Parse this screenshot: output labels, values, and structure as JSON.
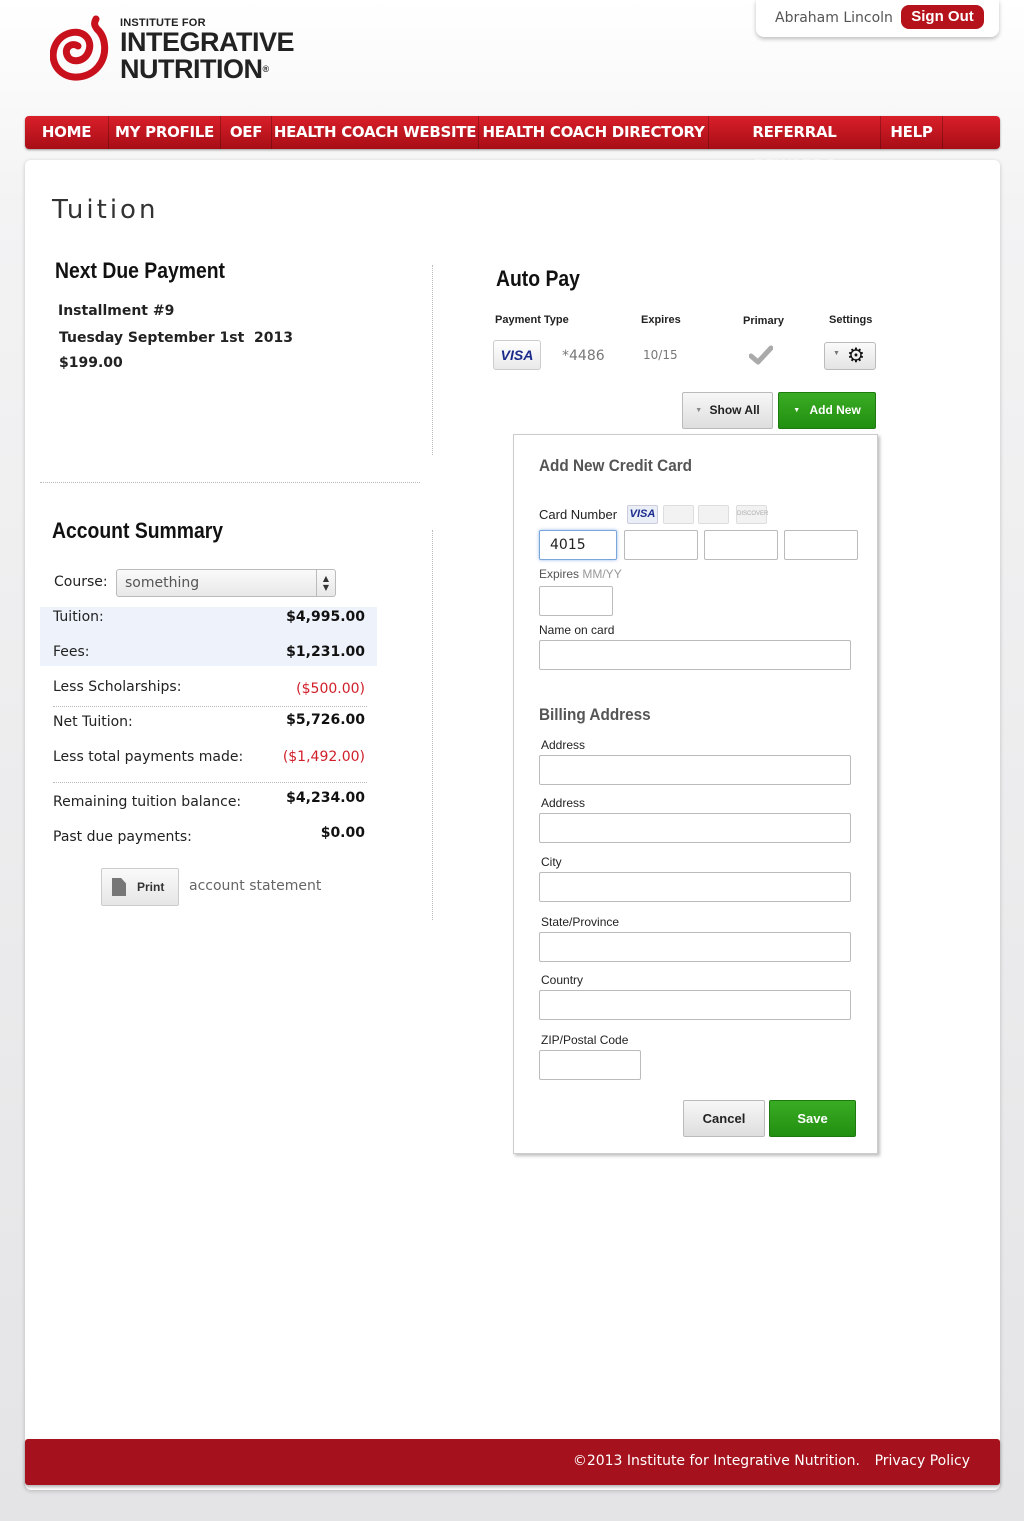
{
  "brand": {
    "logo_top": "INSTITUTE FOR",
    "logo_line1": "INTEGRATIVE",
    "logo_line2": "NUTRITION",
    "registered": "®",
    "accent_color": "#b5121b",
    "green_color": "#2a9a17"
  },
  "user": {
    "name": "Abraham Lincoln",
    "sign_out_label": "Sign Out"
  },
  "nav": {
    "items": [
      {
        "label": "HOME"
      },
      {
        "label": "MY PROFILE"
      },
      {
        "label": "OEF"
      },
      {
        "label": "HEALTH COACH WEBSITE"
      },
      {
        "label": "HEALTH COACH DIRECTORY"
      },
      {
        "label": "REFERRAL REWARDS"
      },
      {
        "label": "HELP"
      }
    ]
  },
  "page": {
    "title": "Tuition"
  },
  "next_due": {
    "heading": "Next Due Payment",
    "installment": "Installment #9",
    "date": "Tuesday September 1st  2013",
    "amount": "$199.00"
  },
  "auto_pay": {
    "heading": "Auto Pay",
    "columns": [
      "Payment Type",
      "Expires",
      "Primary",
      "Settings"
    ],
    "card": {
      "brand": "VISA",
      "number": "*4486",
      "expires": "10/15",
      "primary": true,
      "settings_icon": "gear-icon"
    },
    "show_all_label": "Show All",
    "add_new_label": "Add New"
  },
  "account_summary": {
    "heading": "Account Summary",
    "course_label": "Course:",
    "course_value": "something",
    "rows": [
      {
        "label": "Tuition:",
        "value": "$4,995.00"
      },
      {
        "label": "Fees:",
        "value": "$1,231.00"
      },
      {
        "label": "Less Scholarships:",
        "value": "($500.00)"
      },
      {
        "label": "Net Tuition:",
        "value": "$5,726.00"
      },
      {
        "label": "Less total payments made:",
        "value": "($1,492.00)"
      },
      {
        "label": "Remaining tuition balance:",
        "value": "$4,234.00"
      },
      {
        "label": "Past due payments:",
        "value": "$0.00"
      }
    ],
    "print_label": "Print",
    "statement_label": "account statement"
  },
  "credit_card_form": {
    "heading": "Add New Credit Card",
    "card_number_label": "Card Number",
    "card_brands": [
      "VISA",
      "",
      "",
      "DISCOVER"
    ],
    "card_number_values": [
      "4015",
      "",
      "",
      ""
    ],
    "expires_label": "Expires",
    "expires_hint": "MM/YY",
    "expires_value": "",
    "name_label": "Name on card",
    "name_value": "",
    "billing_heading": "Billing Address",
    "address1_label": "Address",
    "address2_label": "Address",
    "city_label": "City",
    "state_label": "State/Province",
    "country_label": "Country",
    "zip_label": "ZIP/Postal Code",
    "cancel_label": "Cancel",
    "save_label": "Save"
  },
  "footer": {
    "copyright": "©2013 Institute for Integrative Nutrition.",
    "privacy_label": "Privacy Policy"
  }
}
